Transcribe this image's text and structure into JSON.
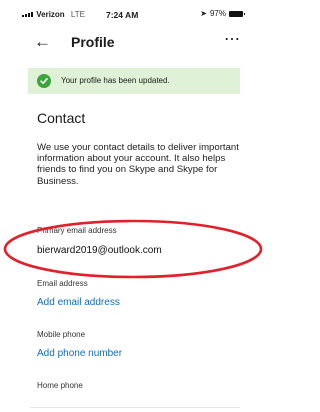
{
  "status_bar": {
    "carrier": "Verizon",
    "network": "LTE",
    "time": "7:24 AM",
    "battery": "97%"
  },
  "header": {
    "title": "Profile",
    "back_icon": "arrow-left-icon",
    "more_icon": "more-horizontal-icon"
  },
  "banner": {
    "text": "Your profile has been updated.",
    "icon": "checkmark-circle-icon",
    "color": "#dff1d6"
  },
  "contact": {
    "title": "Contact",
    "description": "We use your contact details to deliver important information about your account. It also helps friends to find you on Skype and Skype for Business.",
    "primary_email_label": "Primary email address",
    "primary_email_value": "bierward2019@outlook.com",
    "email_label": "Email address",
    "add_email_link": "Add email address",
    "mobile_label": "Mobile phone",
    "add_phone_link": "Add phone number",
    "home_label": "Home phone"
  },
  "colors": {
    "link": "#0f6cbd",
    "annotation": "#e0202a",
    "success": "#3aa53a"
  }
}
